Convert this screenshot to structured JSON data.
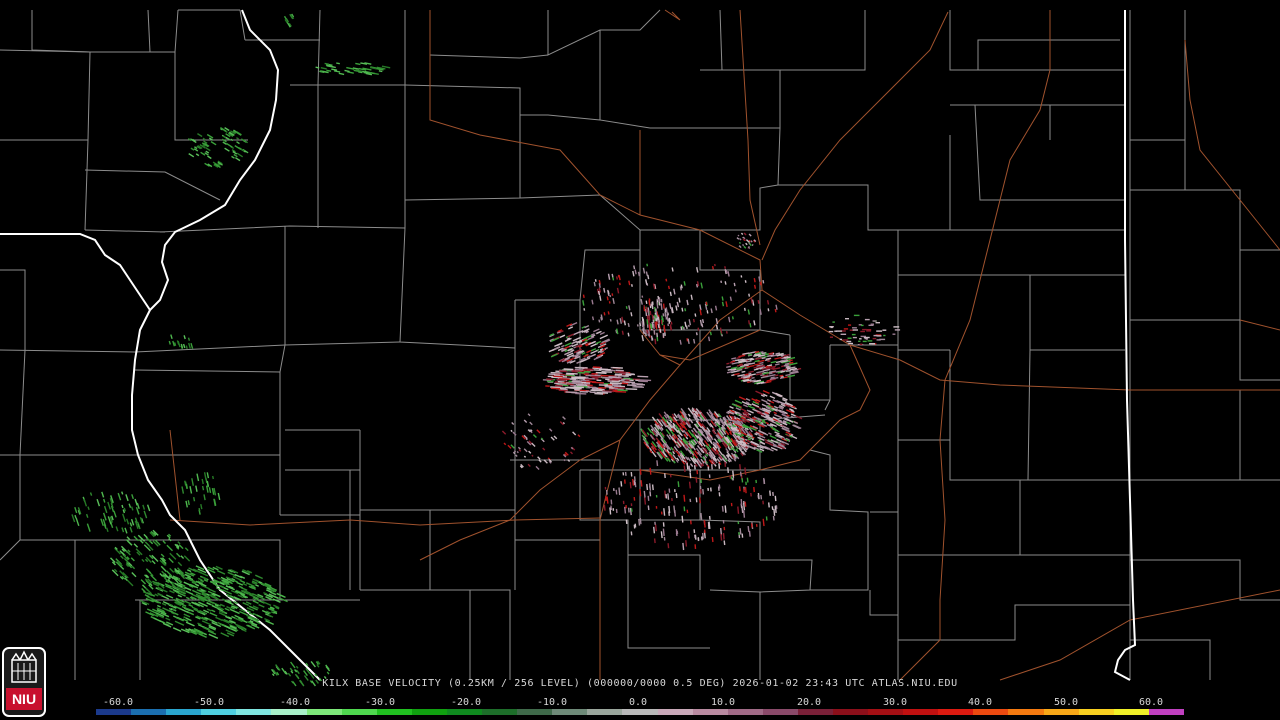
{
  "product": {
    "caption": "KILX BASE VELOCITY (0.25KM / 256 LEVEL) (000000/0000 0.5 DEG) 2026-01-02 23:43 UTC  ATLAS.NIU.EDU",
    "station": "KILX",
    "timestamp": "2026-01-02 23:43 UTC",
    "source": "ATLAS.NIU.EDU"
  },
  "logo": {
    "text": "NIU",
    "colors": {
      "bg": "#1a1a1a",
      "ring": "#ffffff",
      "red": "#c8102e"
    }
  },
  "colorbar": {
    "labels": [
      "-60.0",
      "-50.0",
      "-40.0",
      "-30.0",
      "-20.0",
      "-10.0",
      "0.0",
      "10.0",
      "20.0",
      "30.0",
      "40.0",
      "50.0",
      "60.0"
    ],
    "segments": [
      "#1b3a8c",
      "#1b6fb0",
      "#2aa6cf",
      "#4fd0e0",
      "#7fe6e0",
      "#a8f0c8",
      "#7ee87a",
      "#4fd84f",
      "#20c020",
      "#10a010",
      "#0f8a1f",
      "#1d6e2a",
      "#3f6a4a",
      "#6e8a78",
      "#9aa69c",
      "#b8b8b8",
      "#c8a8b8",
      "#b88aa0",
      "#a06a86",
      "#8a4a6a",
      "#7a2038",
      "#8c0f1a",
      "#a40f14",
      "#c01010",
      "#dc1a10",
      "#ec4a10",
      "#f47a10",
      "#f8a818",
      "#f8d020",
      "#f0f028",
      "#c040c0"
    ]
  },
  "colors": {
    "background": "#000000",
    "county_border": "#8a8a8a",
    "state_border": "#ffffff",
    "highway": "#a0522d",
    "inbound_velocity": "#3aa03a",
    "outbound_velocity": "#c01818",
    "near_zero": "#b8a0b0"
  }
}
